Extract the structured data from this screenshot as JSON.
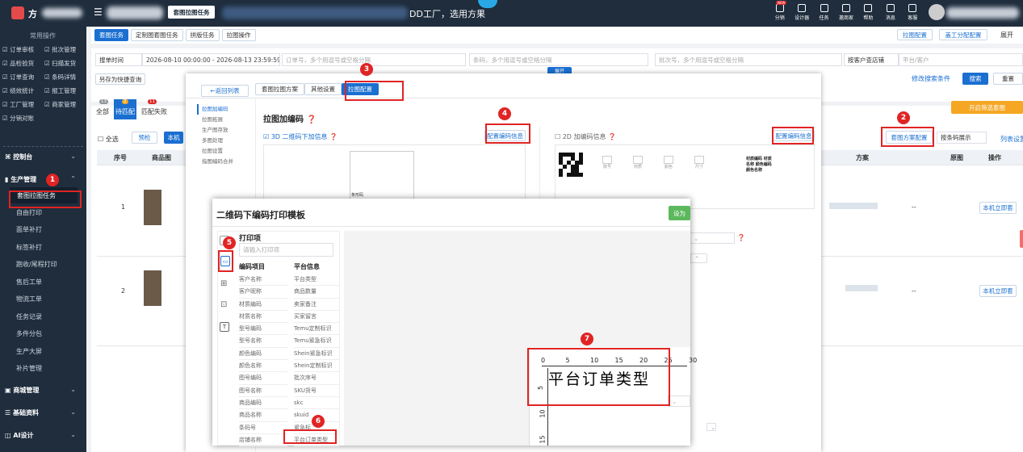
{
  "topbar": {
    "brand": "方",
    "tabs": [
      "套图拉图任务"
    ],
    "slogan": "DD工厂，选用方果",
    "icons": [
      {
        "label": "分销",
        "badge": "NEW"
      },
      {
        "label": "设计器"
      },
      {
        "label": "任务"
      },
      {
        "label": "邀商家"
      },
      {
        "label": "帮助"
      },
      {
        "label": "消息"
      },
      {
        "label": "客服"
      }
    ]
  },
  "sidebar": {
    "section_title": "常用操作",
    "quick": [
      "订单审核",
      "批次管理",
      "品检验货",
      "扫描发货",
      "订单查询",
      "条码详情",
      "绩效统计",
      "报工管理",
      "工厂管理",
      "商家管理",
      "分销对账"
    ],
    "menu": [
      {
        "label": "控制台"
      },
      {
        "label": "生产管理"
      },
      {
        "label": "商城管理"
      },
      {
        "label": "基础资料"
      },
      {
        "label": "AI设计"
      }
    ],
    "sub": [
      "套图拉图任务",
      "自由打印",
      "面单补打",
      "标签补打",
      "跑收/尾程打印",
      "售后工单",
      "物流工单",
      "任务记录",
      "多件分包",
      "生产大屏",
      "补片管理"
    ]
  },
  "tabs": [
    "套图任务",
    "定制图套图任务",
    "拼版任务",
    "拉图操作"
  ],
  "top_right_buttons": [
    "拉图配置",
    "盖工分配配置",
    "展开"
  ],
  "filters": {
    "time_type": "搜单时间",
    "time_range": "2026-08-10 00:00:00  -  2026-08-13 23:59:59",
    "order_ph": "订单号，多个用逗号或空格分隔",
    "barcode_ph": "条码，多个用逗号或空格分隔",
    "batch_ph": "批次号，多个用逗号或空格分隔",
    "shop_type": "按客户查店铺",
    "platform_ph": "平台/客户",
    "save_quick": "另存为快捷查询",
    "expand": "展开",
    "modify_cond": "修改搜索条件",
    "search": "搜索",
    "reset": "重置"
  },
  "status_tabs": [
    {
      "label": "全部",
      "count": "13"
    },
    {
      "label": "待匹配",
      "count": "2"
    },
    {
      "label": "匹配失败",
      "count": "11"
    }
  ],
  "actions": {
    "select_all": "全选",
    "pre": "预检",
    "local": "本机",
    "open_fill": "开启筛选套图",
    "plan_config": "套图方案配置",
    "barcode_show": "按条码展示",
    "col_settings": "列表设置"
  },
  "table": {
    "headers": [
      "序号",
      "商品图",
      "方案",
      "原图",
      "操作"
    ],
    "rows": [
      {
        "no": "1",
        "plan": "--",
        "op": "本机立即套"
      },
      {
        "no": "2",
        "plan": "--",
        "op": "本机立即套"
      }
    ]
  },
  "modal1": {
    "back": "返回列表",
    "tabs": [
      "套图拉图方案",
      "其他设置",
      "拉图配置"
    ],
    "nav": [
      "拉图加编码",
      "拉图拓展",
      "生产图存放",
      "多图处理",
      "拉图设置",
      "指图编码合并"
    ],
    "section_title": "拉图加编码",
    "cb3d": "3D 二维码下加信息",
    "cb2d": "2D 加编码信息",
    "config_btn": "配置编码信息",
    "config_btn2": "配置编码信息",
    "preview_label": "条形码",
    "qr_labels": [
      "款号",
      "材质",
      "颜色",
      "尺寸"
    ],
    "qr_text": "材质编码 材质名称 颜色编码 颜色名称"
  },
  "modal2": {
    "title": "二维码下编码打印模板",
    "set_btn": "设为",
    "section": "打印项",
    "search_ph": "请输入打印项",
    "col_a": "编码项目",
    "col_b": "平台信息",
    "items_a": [
      "客户名称",
      "客户昵称",
      "材质编码",
      "材质名称",
      "型号编码",
      "型号名称",
      "颜色编码",
      "颜色名称",
      "图号编码",
      "图号名称",
      "商品编码",
      "商品名称",
      "条码号",
      "店铺名称"
    ],
    "items_b": [
      "平台类型",
      "商品数量",
      "卖家备注",
      "买家留言",
      "Temu定制标识",
      "Temu紧急标识",
      "Shein紧急标识",
      "Shein定制标识",
      "批次序号",
      "SKU货号",
      "skc",
      "skuid",
      "紧急标",
      "平台订单类型"
    ],
    "canvas_text": "平台订单类型",
    "ruler": [
      "0",
      "5",
      "10",
      "15",
      "20",
      "25",
      "30"
    ],
    "ruler_v": [
      "5",
      "10",
      "15"
    ]
  },
  "markers": [
    "1",
    "2",
    "3",
    "4",
    "5",
    "6",
    "7"
  ]
}
